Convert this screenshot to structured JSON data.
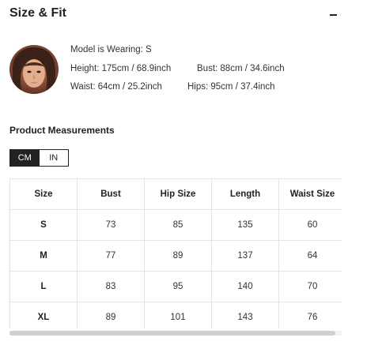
{
  "section": {
    "title": "Size & Fit",
    "collapse_symbol": "−"
  },
  "model": {
    "wearing": "Model is Wearing: S",
    "height": "Height: 175cm / 68.9inch",
    "bust": "Bust: 88cm / 34.6inch",
    "waist": "Waist: 64cm / 25.2inch",
    "hips": "Hips: 95cm / 37.4inch"
  },
  "measurements": {
    "title": "Product Measurements",
    "units": [
      "CM",
      "IN"
    ],
    "active_unit": "CM",
    "columns": [
      "Size",
      "Bust",
      "Hip Size",
      "Length",
      "Waist Size"
    ],
    "rows": [
      [
        "S",
        "73",
        "85",
        "135",
        "60"
      ],
      [
        "M",
        "77",
        "89",
        "137",
        "64"
      ],
      [
        "L",
        "83",
        "95",
        "140",
        "70"
      ],
      [
        "XL",
        "89",
        "101",
        "143",
        "76"
      ]
    ],
    "horizontal_scroll_fraction": 0.98
  },
  "colors": {
    "accent": "#222222",
    "border": "#e3e3e3",
    "text": "#333333"
  }
}
